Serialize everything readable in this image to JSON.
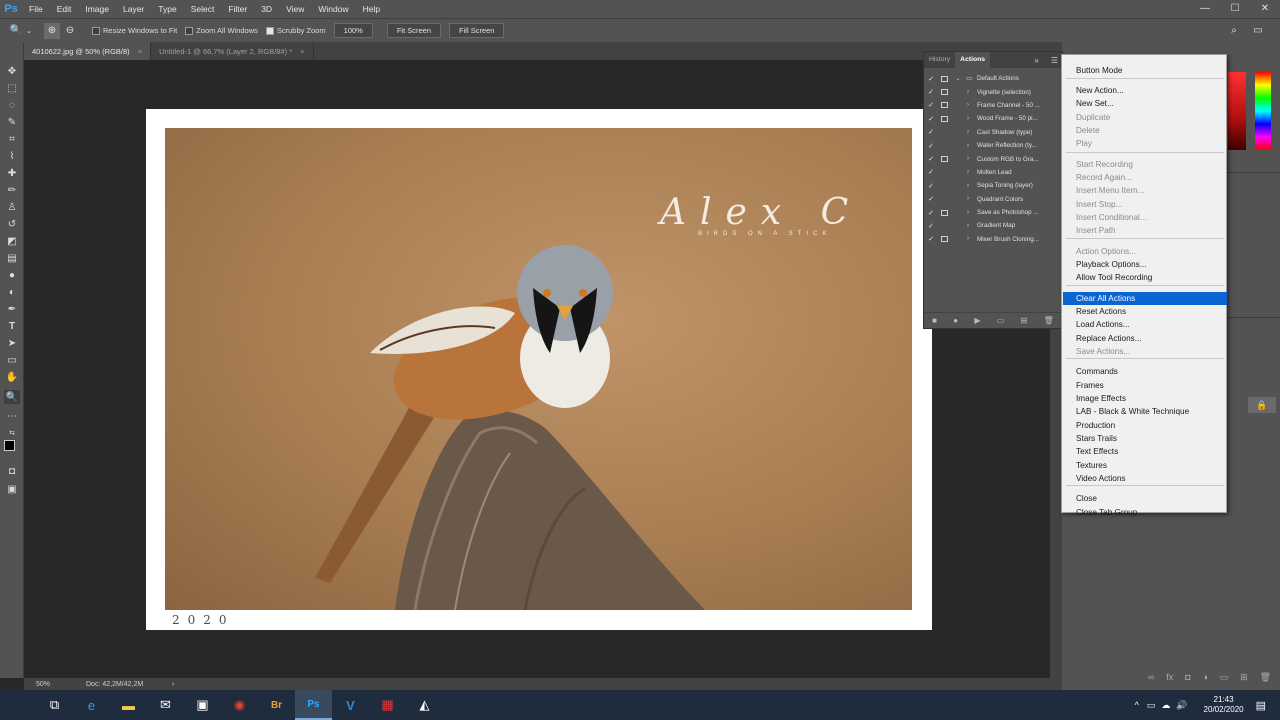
{
  "menubar": {
    "logo": "Ps",
    "items": [
      "File",
      "Edit",
      "Image",
      "Layer",
      "Type",
      "Select",
      "Filter",
      "3D",
      "View",
      "Window",
      "Help"
    ],
    "window_controls": [
      "—",
      "☐",
      "✕"
    ]
  },
  "options": {
    "resize_windows": "Resize Windows to Fit",
    "zoom_all": "Zoom All Windows",
    "scrubby_zoom": "Scrubby Zoom",
    "zoom_value": "100%",
    "fit_screen": "Fit Screen",
    "fill_screen": "Fill Screen"
  },
  "tabs": [
    {
      "label": "4010622.jpg @ 50% (RGB/8)",
      "close": "×"
    },
    {
      "label": "Untitled-1 @ 66,7% (Layer 2, RGB/8#) *",
      "close": "×"
    }
  ],
  "canvas": {
    "watermark_title": "Alex C",
    "watermark_subtitle": "BIRDS ON A STICK",
    "year": "2020"
  },
  "status": {
    "zoom": "50%",
    "doc": "Doc: 42,2M/42,2M",
    "arrow": "›"
  },
  "panel": {
    "tabs": [
      "History",
      "Actions"
    ],
    "rows": [
      {
        "label": "Default Actions",
        "dialog": true,
        "folder": true
      },
      {
        "label": "Vignette (selection)",
        "dialog": true
      },
      {
        "label": "Frame Channel - 50 ...",
        "dialog": true
      },
      {
        "label": "Wood Frame - 50 pi...",
        "dialog": true
      },
      {
        "label": "Cast Shadow (type)",
        "dialog": false
      },
      {
        "label": "Water Reflection (ty...",
        "dialog": false
      },
      {
        "label": "Custom RGB to Gra...",
        "dialog": true
      },
      {
        "label": "Molten Lead",
        "dialog": false
      },
      {
        "label": "Sepia Toning (layer)",
        "dialog": false
      },
      {
        "label": "Quadrant Colors",
        "dialog": false
      },
      {
        "label": "Save as Photoshop ...",
        "dialog": true
      },
      {
        "label": "Gradient Map",
        "dialog": false
      },
      {
        "label": "Mixer Brush Cloning...",
        "dialog": true
      }
    ]
  },
  "context_menu": {
    "items": [
      {
        "label": "Button Mode",
        "state": "normal"
      },
      {
        "label": "New Action...",
        "state": "normal"
      },
      {
        "label": "New Set...",
        "state": "normal"
      },
      {
        "label": "Duplicate",
        "state": "disabled"
      },
      {
        "label": "Delete",
        "state": "disabled"
      },
      {
        "label": "Play",
        "state": "disabled"
      },
      {
        "label": "Start Recording",
        "state": "disabled"
      },
      {
        "label": "Record Again...",
        "state": "disabled"
      },
      {
        "label": "Insert Menu Item...",
        "state": "disabled"
      },
      {
        "label": "Insert Stop...",
        "state": "disabled"
      },
      {
        "label": "Insert Conditional...",
        "state": "disabled"
      },
      {
        "label": "Insert Path",
        "state": "disabled"
      },
      {
        "label": "Action Options...",
        "state": "disabled"
      },
      {
        "label": "Playback Options...",
        "state": "normal"
      },
      {
        "label": "Allow Tool Recording",
        "state": "normal"
      },
      {
        "label": "Clear All Actions",
        "state": "highlighted"
      },
      {
        "label": "Reset Actions",
        "state": "normal"
      },
      {
        "label": "Load Actions...",
        "state": "normal"
      },
      {
        "label": "Replace Actions...",
        "state": "normal"
      },
      {
        "label": "Save Actions...",
        "state": "disabled"
      },
      {
        "label": "Commands",
        "state": "normal"
      },
      {
        "label": "Frames",
        "state": "normal"
      },
      {
        "label": "Image Effects",
        "state": "normal"
      },
      {
        "label": "LAB - Black & White Technique",
        "state": "normal"
      },
      {
        "label": "Production",
        "state": "normal"
      },
      {
        "label": "Stars Trails",
        "state": "normal"
      },
      {
        "label": "Text Effects",
        "state": "normal"
      },
      {
        "label": "Textures",
        "state": "normal"
      },
      {
        "label": "Video Actions",
        "state": "normal"
      },
      {
        "label": "Close",
        "state": "normal"
      },
      {
        "label": "Close Tab Group",
        "state": "normal"
      }
    ]
  },
  "taskbar": {
    "clock_time": "21:43",
    "clock_date": "20/02/2020",
    "apps": [
      "task-view",
      "edge",
      "file-explorer",
      "mail",
      "store",
      "chrome",
      "bridge",
      "photoshop",
      "vegas",
      "media-app",
      "photos"
    ]
  }
}
